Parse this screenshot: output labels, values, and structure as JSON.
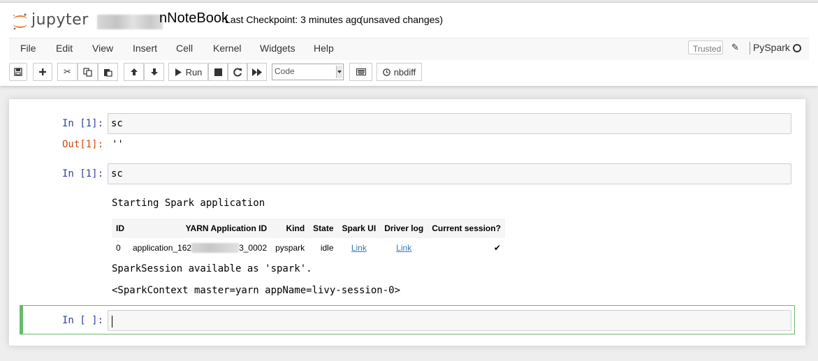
{
  "header": {
    "logo_text": "jupyter",
    "notebook_name_suffix": "nNoteBook",
    "checkpoint": "Last Checkpoint: 3 minutes ago",
    "status": "(unsaved changes)"
  },
  "menu": {
    "items": [
      "File",
      "Edit",
      "View",
      "Insert",
      "Cell",
      "Kernel",
      "Widgets",
      "Help"
    ],
    "trusted": "Trusted",
    "kernel_name": "PySpark"
  },
  "toolbar": {
    "run_label": "Run",
    "cell_type": "Code",
    "nbdiff_label": "nbdiff"
  },
  "cells": {
    "c1": {
      "prompt_in": "In [1]:",
      "source": "sc",
      "prompt_out": "Out[1]:",
      "output": "''"
    },
    "c2": {
      "prompt_in": "In [1]:",
      "source": "sc",
      "output_line1": "Starting Spark application",
      "table": {
        "headers": [
          "ID",
          "YARN Application ID",
          "Kind",
          "State",
          "Spark UI",
          "Driver log",
          "Current session?"
        ],
        "row": {
          "id": "0",
          "app_id_prefix": "application_162",
          "app_id_suffix": "3_0002",
          "kind": "pyspark",
          "state": "idle",
          "spark_ui": "Link",
          "driver_log": "Link",
          "current": "✔"
        }
      },
      "output_line2": "SparkSession available as 'spark'.",
      "output_line3": "<SparkContext master=yarn appName=livy-session-0>"
    },
    "c3": {
      "prompt_in": "In [ ]:",
      "source": ""
    }
  }
}
